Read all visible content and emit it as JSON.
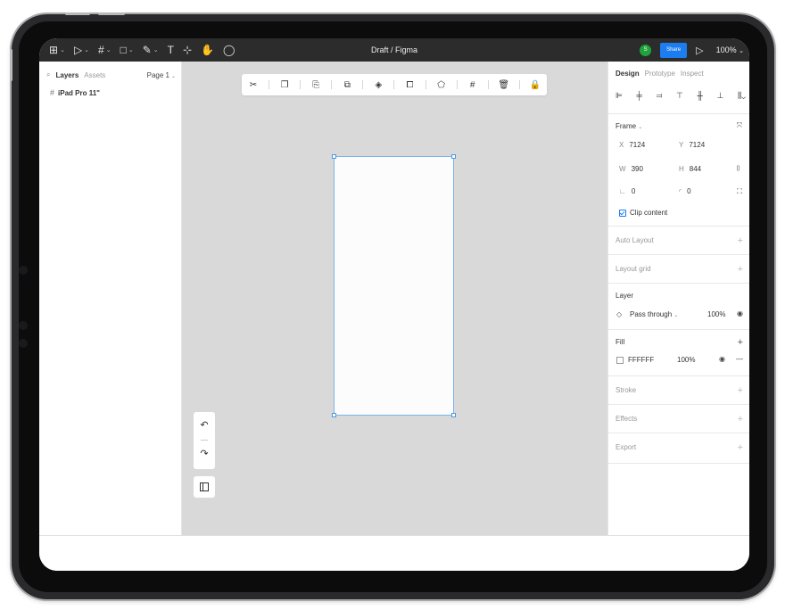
{
  "toolbar": {
    "tools": [
      {
        "icon": "main-menu-icon",
        "glyph": "⊞",
        "chevron": true
      },
      {
        "icon": "move-tool-icon",
        "glyph": "▷",
        "chevron": true
      },
      {
        "icon": "frame-tool-icon",
        "glyph": "#",
        "chevron": true
      },
      {
        "icon": "shape-tool-icon",
        "glyph": "□",
        "chevron": true
      },
      {
        "icon": "pen-tool-icon",
        "glyph": "✎",
        "chevron": true
      },
      {
        "icon": "text-tool-icon",
        "glyph": "T",
        "chevron": false
      },
      {
        "icon": "resources-icon",
        "glyph": "⊹",
        "chevron": false
      },
      {
        "icon": "hand-tool-icon",
        "glyph": "✋",
        "chevron": false
      },
      {
        "icon": "comment-tool-icon",
        "glyph": "◯",
        "chevron": false
      }
    ],
    "title": "Draft / Figma",
    "avatar_initial": "S",
    "share_label": "Share",
    "zoom": "100%",
    "accent_color": "#1c7df0",
    "avatar_color": "#1fa33a"
  },
  "left_panel": {
    "tabs": [
      "Layers",
      "Assets"
    ],
    "page": "Page 1",
    "layers": [
      {
        "name": "iPad Pro 11\""
      }
    ]
  },
  "context_toolbar": {
    "icons": [
      "scissors-icon",
      "copy-icon",
      "paste-icon",
      "group-icon",
      "layers-icon",
      "component-icon",
      "mask-icon",
      "grid-icon",
      "delete-icon",
      "lock-icon"
    ]
  },
  "right_panel": {
    "tabs": [
      "Design",
      "Prototype",
      "Inspect"
    ],
    "frame": {
      "title": "Frame",
      "x_label": "X",
      "x": "7124",
      "y_label": "Y",
      "y": "7124",
      "w_label": "W",
      "w": "390",
      "h_label": "H",
      "h": "844",
      "rotation": "0",
      "radius": "0",
      "clip_label": "Clip content"
    },
    "auto_layout": "Auto Layout",
    "layout_grid": "Layout grid",
    "layer": {
      "title": "Layer",
      "blend": "Pass through",
      "opacity": "100%"
    },
    "fill": {
      "title": "Fill",
      "hex": "FFFFFF",
      "opacity": "100%"
    },
    "stroke": "Stroke",
    "effects": "Effects",
    "export": "Export"
  }
}
